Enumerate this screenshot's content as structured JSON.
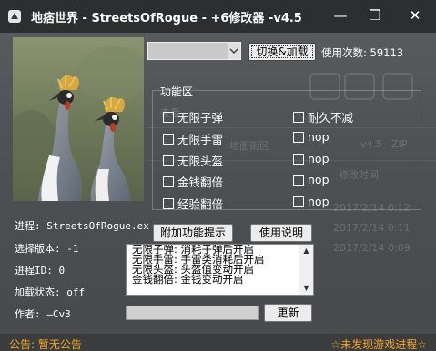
{
  "window": {
    "title": "地痞世界 - StreetsOfRogue - +6修改器 -v4.5",
    "minimize_glyph": "—",
    "restore_glyph": "❐",
    "close_glyph": "✕"
  },
  "toolbar": {
    "version_select_value": "",
    "switch_load_label": "切换&加载",
    "usage_count_label": "使用次数: 59113"
  },
  "features": {
    "group_title": "功能区",
    "items": [
      {
        "label": "无限子弹",
        "checked": false
      },
      {
        "label": "耐久不减",
        "checked": false
      },
      {
        "label": "无限手雷",
        "checked": false
      },
      {
        "label": "nop",
        "checked": false
      },
      {
        "label": "无限头盔",
        "checked": false
      },
      {
        "label": "nop",
        "checked": false
      },
      {
        "label": "金钱翻倍",
        "checked": false
      },
      {
        "label": "nop",
        "checked": false
      },
      {
        "label": "经验翻倍",
        "checked": false
      },
      {
        "label": "nop",
        "checked": false
      }
    ]
  },
  "info": {
    "process": "进程: StreetsOfRogue.ex",
    "select_version": "选择版本: -1",
    "process_id": "进程ID: 0",
    "load_status": "加载状态: off",
    "author": "作者: —Cv3"
  },
  "actions": {
    "extra_hints_label": "附加功能提示",
    "usage_guide_label": "使用说明",
    "update_label": "更新"
  },
  "log": {
    "lines": [
      "无限子弹: 消耗子弹后开启",
      "无限手雷: 手雷类消耗后开启",
      "无限头盔: 头盔值变动开启",
      "金钱翻倍: 金钱变动开启"
    ]
  },
  "status": {
    "announcement": "公告: 暂无公告",
    "game_status": "☆未发现游戏进程☆"
  },
  "background_ghost": {
    "texts": [
      "查看",
      "地面街区",
      "v4.5",
      "ZIP",
      "下载",
      "2017/2/14 0:12",
      "2017/2/14 0:11",
      "2017/2/14 0:09",
      "修改时间"
    ]
  },
  "colors": {
    "status_text": "#f5a623",
    "window_bg": "#4e5254",
    "titlebar_bg": "#2c2e2f"
  }
}
